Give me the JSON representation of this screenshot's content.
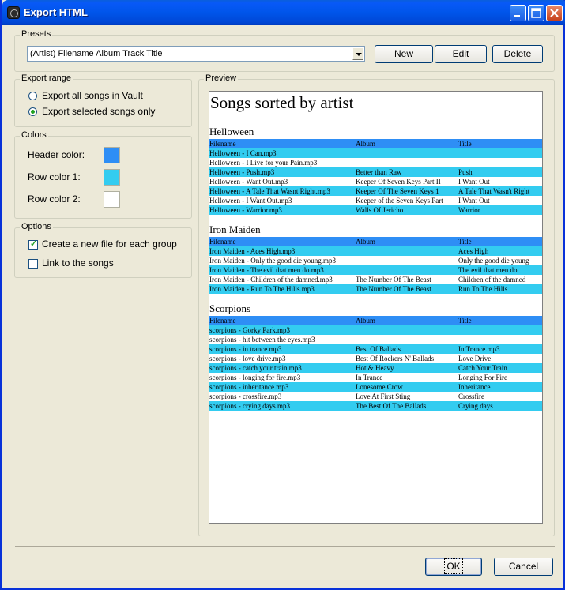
{
  "window": {
    "title": "Export HTML"
  },
  "presets": {
    "label": "Presets",
    "selected": "(Artist) Filename Album Track Title",
    "new_label": "New",
    "edit_label": "Edit",
    "delete_label": "Delete"
  },
  "export_range": {
    "label": "Export range",
    "option_all": "Export all songs in Vault",
    "option_selected": "Export selected songs only",
    "selected": "selected"
  },
  "colors": {
    "label": "Colors",
    "header_label": "Header color:",
    "row1_label": "Row color 1:",
    "row2_label": "Row color 2:",
    "header_color": "#2e8ef5",
    "row1_color": "#33ccf0",
    "row2_color": "#ffffff"
  },
  "options": {
    "label": "Options",
    "new_file_label": "Create a new file for each group",
    "new_file_checked": true,
    "link_label": "Link to the songs",
    "link_checked": false
  },
  "preview": {
    "label": "Preview",
    "title": "Songs sorted by artist",
    "columns": [
      "Filename",
      "Album",
      "Title"
    ],
    "groups": [
      {
        "name": "Helloween",
        "rows": [
          [
            "Helloween - I Can.mp3",
            "",
            ""
          ],
          [
            "Helloween - I Live for your Pain.mp3",
            "",
            ""
          ],
          [
            "Helloween - Push.mp3",
            "Better than Raw",
            "Push"
          ],
          [
            "Helloween -  Want Out.mp3",
            "Keeper Of Seven Keys Part II",
            "I Want Out"
          ],
          [
            "Helloween - A Tale That Wasnt Right.mp3",
            "Keeper Of The Seven Keys 1",
            "A Tale That Wasn't Right"
          ],
          [
            "Helloween - I Want Out.mp3",
            "Keeper of the Seven Keys Part",
            "I Want Out"
          ],
          [
            "Helloween - Warrior.mp3",
            "Walls Of Jericho",
            "Warrior"
          ]
        ]
      },
      {
        "name": "Iron Maiden",
        "rows": [
          [
            "Iron Maiden - Aces High.mp3",
            "",
            "Aces High"
          ],
          [
            "Iron Maiden - Only the good die young.mp3",
            "",
            "Only the good die young"
          ],
          [
            "Iron Maiden - The evil that men do.mp3",
            "",
            "The evil that men do"
          ],
          [
            "Iron Maiden - Children of the damned.mp3",
            "The Number Of The Beast",
            "Children of the damned"
          ],
          [
            "Iron Maiden - Run To The Hills.mp3",
            "The Number Of The Beast",
            "Run To The Hills"
          ]
        ]
      },
      {
        "name": "Scorpions",
        "rows": [
          [
            "scorpions - Gorky Park.mp3",
            "",
            ""
          ],
          [
            "scorpions - hit between the eyes.mp3",
            "",
            ""
          ],
          [
            "scorpions - in trance.mp3",
            "Best Of Ballads",
            "In Trance.mp3"
          ],
          [
            "scorpions - love drive.mp3",
            "Best Of Rockers N' Ballads",
            "Love Drive"
          ],
          [
            "scorpions - catch your train.mp3",
            "Hot & Heavy",
            "Catch Your Train"
          ],
          [
            "scorpions - longing for fire.mp3",
            "In Trance",
            "Longing For Fire"
          ],
          [
            "scorpions - inheritance.mp3",
            "Lonesome Crow",
            "Inheritance"
          ],
          [
            "scorpions - crossfire.mp3",
            "Love At First Sting",
            "Crossfire"
          ],
          [
            "scorpions - crying days.mp3",
            "The Best Of The Ballads",
            "Crying days"
          ]
        ]
      }
    ]
  },
  "footer": {
    "ok_label": "OK",
    "cancel_label": "Cancel"
  }
}
